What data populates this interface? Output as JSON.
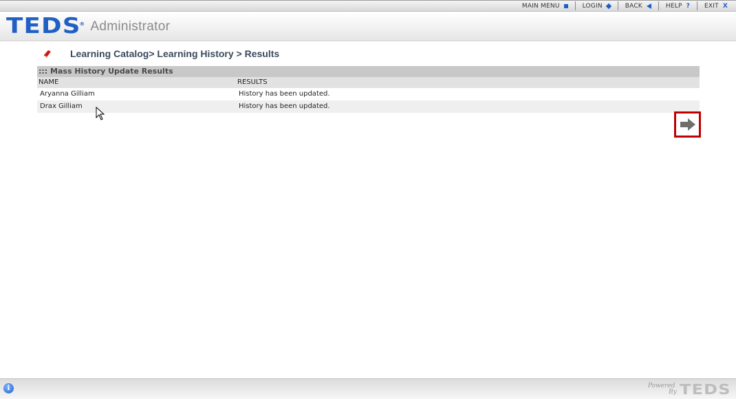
{
  "topnav": {
    "items": [
      {
        "label": "MAIN MENU",
        "icon": "square-icon"
      },
      {
        "label": "LOGIN",
        "icon": "diamond-icon"
      },
      {
        "label": "BACK",
        "icon": "back-arrow-icon"
      },
      {
        "label": "HELP",
        "icon": "question-icon",
        "glyph": "?"
      },
      {
        "label": "EXIT",
        "icon": "close-icon",
        "glyph": "X"
      }
    ]
  },
  "header": {
    "logo_text": "TEDS",
    "logo_reg": "®",
    "app_title": "Administrator"
  },
  "breadcrumb": {
    "text": "Learning Catalog> Learning History > Results"
  },
  "results": {
    "title": "::: Mass History Update Results",
    "columns": [
      "NAME",
      "RESULTS"
    ],
    "rows": [
      {
        "name": "Aryanna Gilliam",
        "result": "History has been updated."
      },
      {
        "name": "Drax Gilliam",
        "result": "History has been updated."
      }
    ]
  },
  "footer": {
    "powered_line1": "Powered",
    "powered_line2": "By",
    "powered_logo": "TEDS"
  },
  "colors": {
    "brand_blue": "#2060c4",
    "highlight_red": "#c00000",
    "panel_header": "#c8c8c8"
  }
}
